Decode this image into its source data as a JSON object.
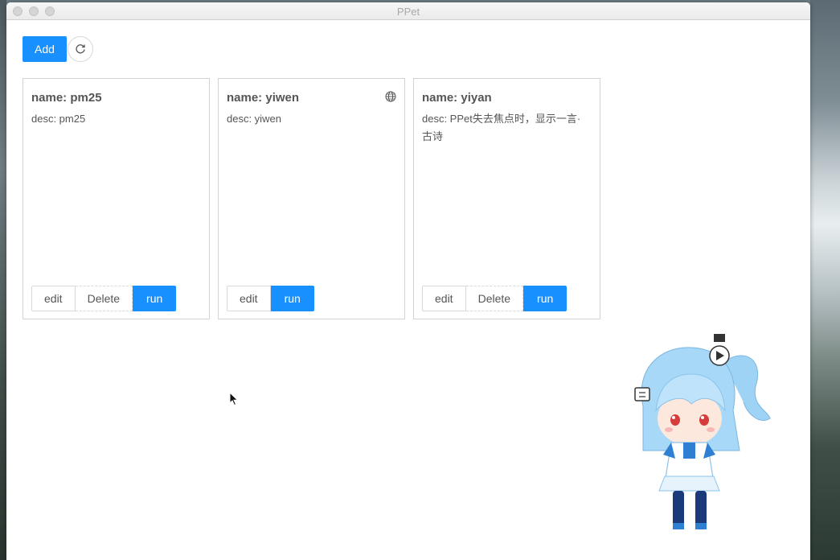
{
  "window": {
    "title": "PPet"
  },
  "toolbar": {
    "add_label": "Add",
    "refresh_icon": "refresh-icon"
  },
  "cards": [
    {
      "name": "name: pm25",
      "desc": "desc: pm25",
      "edit": "edit",
      "delete": "Delete",
      "run": "run"
    },
    {
      "name": "name: yiwen",
      "desc": "desc: yiwen",
      "edit": "edit",
      "run": "run",
      "icon": "globe-icon"
    },
    {
      "name": "name: yiyan",
      "desc": "desc: PPet失去焦点时，显示一言·古诗",
      "edit": "edit",
      "delete": "Delete",
      "run": "run"
    }
  ],
  "colors": {
    "primary": "#1890ff",
    "border": "#d9d9d9",
    "text": "#555555"
  }
}
